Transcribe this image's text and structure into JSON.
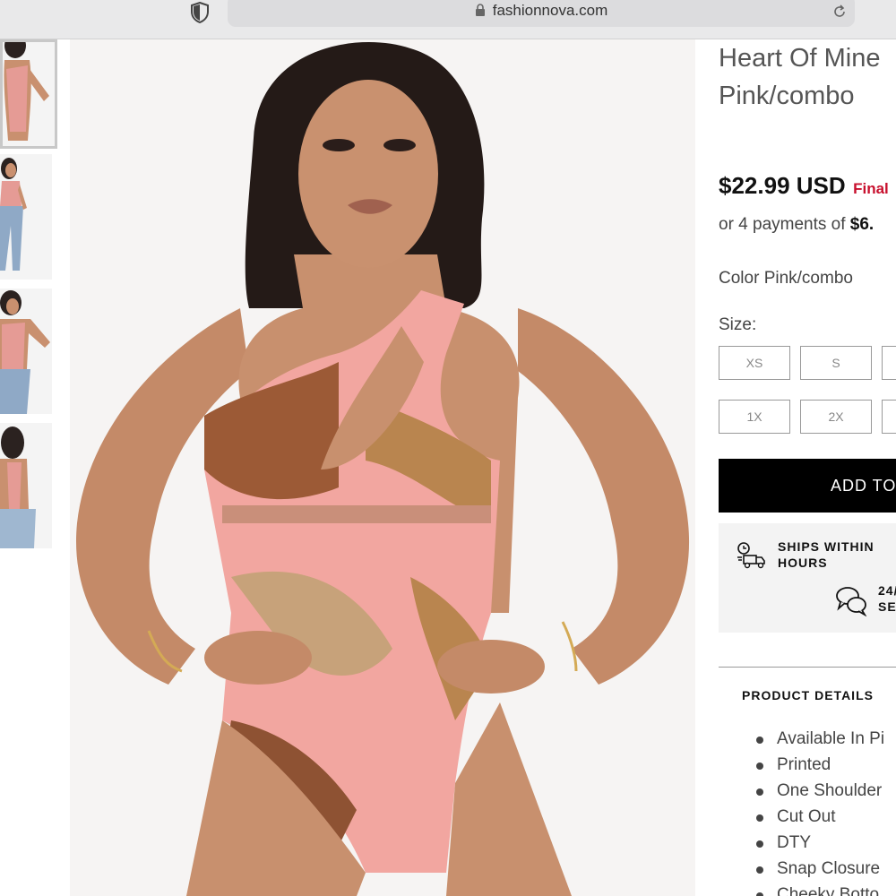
{
  "browser": {
    "url": "fashionnova.com",
    "icons": [
      "shield-icon",
      "lock-icon",
      "reload-icon"
    ]
  },
  "product": {
    "title_line1": "Heart Of Mine",
    "title_line2": "Pink/combo",
    "price": "$22.99 USD",
    "final_sale": "Final",
    "payments_prefix": "or 4 payments of ",
    "payments_amount": "$6.",
    "color_label": "Color",
    "color_value": "Pink/combo",
    "size_label": "Size:",
    "sizes": [
      "XS",
      "S",
      "",
      "1X",
      "2X",
      ""
    ],
    "add_to_bag": "ADD TO",
    "ships_line1": "SHIPS WITHIN",
    "ships_line2": "HOURS",
    "support_line1": "24/",
    "support_line2": "SE",
    "details_title": "PRODUCT DETAILS",
    "details": [
      "Available In Pi",
      "Printed",
      "One Shoulder",
      "Cut Out",
      "DTY",
      "Snap Closure",
      "Cheeky Botto"
    ]
  },
  "colors": {
    "accent_black": "#000000",
    "sale_red": "#c8102e",
    "swimsuit_pink": "#f2a6a0"
  }
}
